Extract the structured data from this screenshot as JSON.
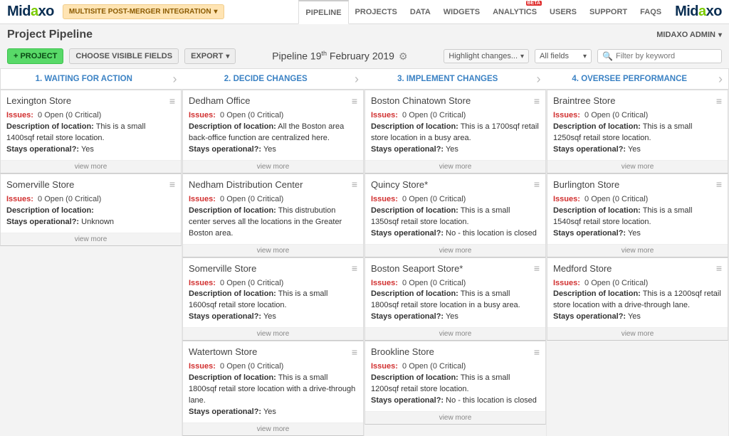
{
  "brand": {
    "a": "Mid",
    "b": "a",
    "c": "xo"
  },
  "context": "MULTISITE POST-MERGER INTEGRATION",
  "nav": [
    "PIPELINE",
    "PROJECTS",
    "DATA",
    "WIDGETS",
    "ANALYTICS",
    "USERS",
    "SUPPORT",
    "FAQS"
  ],
  "beta": "BETA",
  "pageTitle": "Project Pipeline",
  "userMenu": "MIDAXO ADMIN",
  "toolbar": {
    "project": "PROJECT",
    "choose": "CHOOSE VISIBLE FIELDS",
    "export": "EXPORT",
    "pipelinePrefix": "Pipeline 19",
    "pipelineSup": "th",
    "pipelineSuffix": " February 2019",
    "highlight": "Highlight changes...",
    "allfields": "All fields",
    "searchPlaceholder": "Filter by keyword"
  },
  "stages": [
    "1. WAITING FOR ACTION",
    "2. DECIDE CHANGES",
    "3. IMPLEMENT CHANGES",
    "4. OVERSEE PERFORMANCE"
  ],
  "labels": {
    "issues": "Issues:",
    "issuesVal": "0 Open  (0 Critical)",
    "desc": "Description of location:",
    "stays": "Stays operational?:",
    "viewmore": "view more"
  },
  "columns": [
    [
      {
        "title": "Lexington Store",
        "desc": "This is a small 1400sqf retail store location.",
        "stays": "Yes"
      },
      {
        "title": "Somerville Store",
        "desc": "",
        "stays": "Unknown"
      }
    ],
    [
      {
        "title": "Dedham Office",
        "desc": "All the Boston area back-office function are centralized here.",
        "stays": "Yes"
      },
      {
        "title": "Nedham Distribution Center",
        "desc": "This distrubution center serves all the locations in the Greater Boston area.",
        "stays": ""
      },
      {
        "title": "Somerville Store",
        "desc": "This is a small 1600sqf retail store location.",
        "stays": "Yes"
      },
      {
        "title": "Watertown Store",
        "desc": "This is a small 1800sqf retail store location with a drive-through lane.",
        "stays": "Yes"
      }
    ],
    [
      {
        "title": "Boston Chinatown Store",
        "desc": "This is a 1700sqf retail store location in a busy area.",
        "stays": "Yes"
      },
      {
        "title": "Quincy Store*",
        "desc": "This is a small 1350sqf retail store location.",
        "stays": "No - this location is closed"
      },
      {
        "title": "Boston Seaport Store*",
        "desc": "This is a small 1800sqf retail store location in a busy area.",
        "stays": "Yes"
      },
      {
        "title": "Brookline Store",
        "desc": "This is a small 1200sqf retail store location.",
        "stays": "No - this location is closed"
      }
    ],
    [
      {
        "title": "Braintree Store",
        "desc": "This is a small 1250sqf retail store location.",
        "stays": "Yes"
      },
      {
        "title": "Burlington Store",
        "desc": "This is a small 1540sqf retail store location.",
        "stays": "Yes"
      },
      {
        "title": "Medford Store",
        "desc": "This is a 1200sqf retail store location with a drive-through lane.",
        "stays": "Yes"
      }
    ]
  ]
}
